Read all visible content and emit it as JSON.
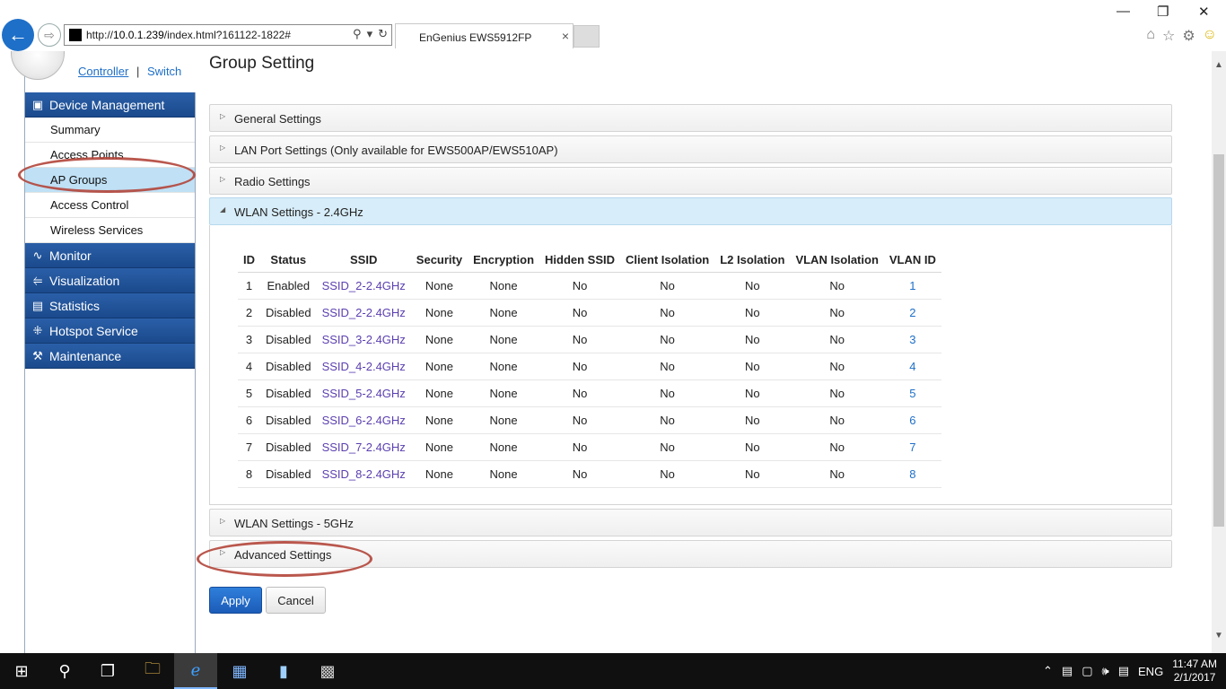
{
  "browser": {
    "url_prefix": "http://",
    "url_host": "10.0.1.239",
    "url_path": "/index.html?161122-1822#",
    "tab_title": "EnGenius EWS5912FP",
    "tab_close": "×",
    "win_minimize": "—",
    "win_restore": "❐",
    "win_close": "✕"
  },
  "header": {
    "controller": "Controller",
    "separator": "|",
    "switch": "Switch"
  },
  "sidebar": {
    "device_management": "Device Management",
    "items": [
      "Summary",
      "Access Points",
      "AP Groups",
      "Access Control",
      "Wireless Services"
    ],
    "active_item": "AP Groups",
    "monitor": "Monitor",
    "visualization": "Visualization",
    "statistics": "Statistics",
    "hotspot": "Hotspot Service",
    "maintenance": "Maintenance"
  },
  "main": {
    "title": "Group Setting",
    "accordions": {
      "general": "General Settings",
      "lan": "LAN Port Settings (Only available for EWS500AP/EWS510AP)",
      "radio": "Radio Settings",
      "wlan24": "WLAN Settings - 2.4GHz",
      "wlan5": "WLAN Settings - 5GHz",
      "advanced": "Advanced Settings"
    },
    "table": {
      "headers": [
        "ID",
        "Status",
        "SSID",
        "Security",
        "Encryption",
        "Hidden SSID",
        "Client Isolation",
        "L2 Isolation",
        "VLAN Isolation",
        "VLAN ID"
      ],
      "rows": [
        [
          "1",
          "Enabled",
          "SSID_2-2.4GHz",
          "None",
          "None",
          "No",
          "No",
          "No",
          "No",
          "1"
        ],
        [
          "2",
          "Disabled",
          "SSID_2-2.4GHz",
          "None",
          "None",
          "No",
          "No",
          "No",
          "No",
          "2"
        ],
        [
          "3",
          "Disabled",
          "SSID_3-2.4GHz",
          "None",
          "None",
          "No",
          "No",
          "No",
          "No",
          "3"
        ],
        [
          "4",
          "Disabled",
          "SSID_4-2.4GHz",
          "None",
          "None",
          "No",
          "No",
          "No",
          "No",
          "4"
        ],
        [
          "5",
          "Disabled",
          "SSID_5-2.4GHz",
          "None",
          "None",
          "No",
          "No",
          "No",
          "No",
          "5"
        ],
        [
          "6",
          "Disabled",
          "SSID_6-2.4GHz",
          "None",
          "None",
          "No",
          "No",
          "No",
          "No",
          "6"
        ],
        [
          "7",
          "Disabled",
          "SSID_7-2.4GHz",
          "None",
          "None",
          "No",
          "No",
          "No",
          "No",
          "7"
        ],
        [
          "8",
          "Disabled",
          "SSID_8-2.4GHz",
          "None",
          "None",
          "No",
          "No",
          "No",
          "No",
          "8"
        ]
      ]
    },
    "apply": "Apply",
    "cancel": "Cancel"
  },
  "taskbar": {
    "language": "ENG",
    "time": "11:47 AM",
    "date": "2/1/2017"
  },
  "colors": {
    "sidebar_header": "#1b4a8d",
    "active_item": "#bfe0f5",
    "link": "#1e6fc8",
    "ssid": "#5b3fb0",
    "annotation_ring": "#b3453a"
  }
}
